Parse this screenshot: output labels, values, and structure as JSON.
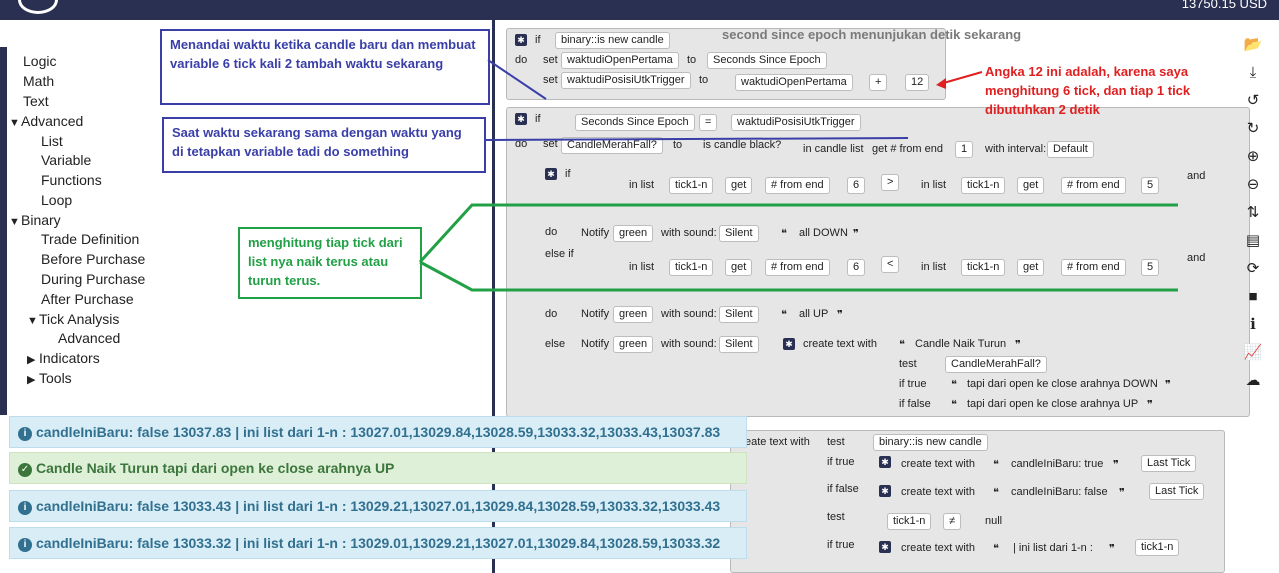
{
  "header": {
    "balance": "13750.15 USD"
  },
  "toolbox": {
    "items": [
      {
        "label": "Logic"
      },
      {
        "label": "Math"
      },
      {
        "label": "Text"
      },
      {
        "label": "Advanced"
      },
      {
        "label": "List"
      },
      {
        "label": "Variable"
      },
      {
        "label": "Functions"
      },
      {
        "label": "Loop"
      },
      {
        "label": "Binary"
      },
      {
        "label": "Trade Definition"
      },
      {
        "label": "Before Purchase"
      },
      {
        "label": "During Purchase"
      },
      {
        "label": "After Purchase"
      },
      {
        "label": "Tick Analysis"
      },
      {
        "label": "Advanced"
      },
      {
        "label": "Indicators"
      },
      {
        "label": "Tools"
      }
    ],
    "expanded_caret": "▼",
    "collapsed_caret": "▶"
  },
  "annotations": {
    "note1": "Menandai waktu ketika candle baru dan membuat variable 6 tick kali 2 tambah waktu sekarang",
    "note2": "Saat waktu sekarang sama dengan waktu yang di tetapkan variable tadi do something",
    "note3": "menghitung tiap tick dari list nya naik terus atau turun terus.",
    "red_note": "Angka 12 ini adalah, karena saya menghitung 6 tick, dan tiap 1 tick dibutuhkan 2 detik",
    "grey_note": "second since epoch menunjukan detik sekarang"
  },
  "blocks": {
    "if": "if",
    "do": "do",
    "else_if": "else if",
    "else": "else",
    "set": "set",
    "to": "to",
    "and": "and",
    "binary_new_candle": "binary::is new candle",
    "var_open": "waktudiOpenPertama",
    "var_trigger": "waktudiPosisiUtkTrigger",
    "seconds_since_epoch": "Seconds Since Epoch",
    "plus": "+",
    "num_12": "12",
    "eq": "=",
    "var_candle": "CandleMerahFall?",
    "is_candle_black": "is candle black?",
    "in_candle_list": "in candle list",
    "get_from_end": "get # from end",
    "num_1": "1",
    "with_interval": "with interval:",
    "default": "Default",
    "in_list": "in list",
    "tick_var": "tick1-n",
    "get": "get",
    "from_end": "# from end",
    "num_6": "6",
    "num_5": "5",
    "gt": ">",
    "lt": "<",
    "notify": "Notify",
    "green": "green",
    "with_sound": "with sound:",
    "silent": "Silent",
    "all_down": "all DOWN",
    "all_up": "all UP",
    "create_text_with": "create text with",
    "candle_naik_turun": "Candle Naik Turun",
    "test": "test",
    "if_true": "if true",
    "if_false": "if false",
    "down_text": "tapi dari open ke close arahnya DOWN",
    "up_text": "tapi dari open ke close arahnya UP",
    "eate_text_with": "eate text with",
    "candle_ini_baru_true": "candleIniBaru: true",
    "candle_ini_baru_false": "candleIniBaru: false",
    "last_tick": "Last Tick",
    "neq": "≠",
    "null": "null",
    "ini_list": "| ini list dari 1-n :",
    "quote": "❝",
    "quote_close": "❞"
  },
  "log": [
    {
      "type": "info",
      "text": "candleIniBaru: false 13037.83 | ini list dari 1-n : 13027.01,13029.84,13028.59,13033.32,13033.43,13037.83"
    },
    {
      "type": "success",
      "text": "Candle Naik Turun tapi dari open ke close arahnya UP"
    },
    {
      "type": "info",
      "text": "candleIniBaru: false 13033.43 | ini list dari 1-n : 13029.21,13027.01,13029.84,13028.59,13033.32,13033.43"
    },
    {
      "type": "info",
      "text": "candleIniBaru: false 13033.32 | ini list dari 1-n : 13029.01,13029.21,13027.01,13029.84,13028.59,13033.32"
    }
  ],
  "log_icons": {
    "info": "i",
    "success": "✓"
  },
  "right_toolbar": [
    {
      "icon": "folder-open-icon",
      "glyph": "📂"
    },
    {
      "icon": "download-icon",
      "glyph": "⤓"
    },
    {
      "icon": "undo-icon",
      "glyph": "↺"
    },
    {
      "icon": "redo-icon",
      "glyph": "↻"
    },
    {
      "icon": "zoom-in-icon",
      "glyph": "⊕"
    },
    {
      "icon": "zoom-out-icon",
      "glyph": "⊖"
    },
    {
      "icon": "sort-icon",
      "glyph": "⇅"
    },
    {
      "icon": "document-icon",
      "glyph": "▤"
    },
    {
      "icon": "refresh-icon",
      "glyph": "⟳"
    },
    {
      "icon": "stop-icon",
      "glyph": "■"
    },
    {
      "icon": "info-icon",
      "glyph": "ℹ"
    },
    {
      "icon": "chart-icon",
      "glyph": "📈"
    },
    {
      "icon": "cloud-icon",
      "glyph": "☁"
    }
  ],
  "colors": {
    "topbar": "#2a3052",
    "annotation_blue": "#3a3fa8",
    "annotation_green": "#22a046",
    "annotation_red": "#e02020"
  }
}
